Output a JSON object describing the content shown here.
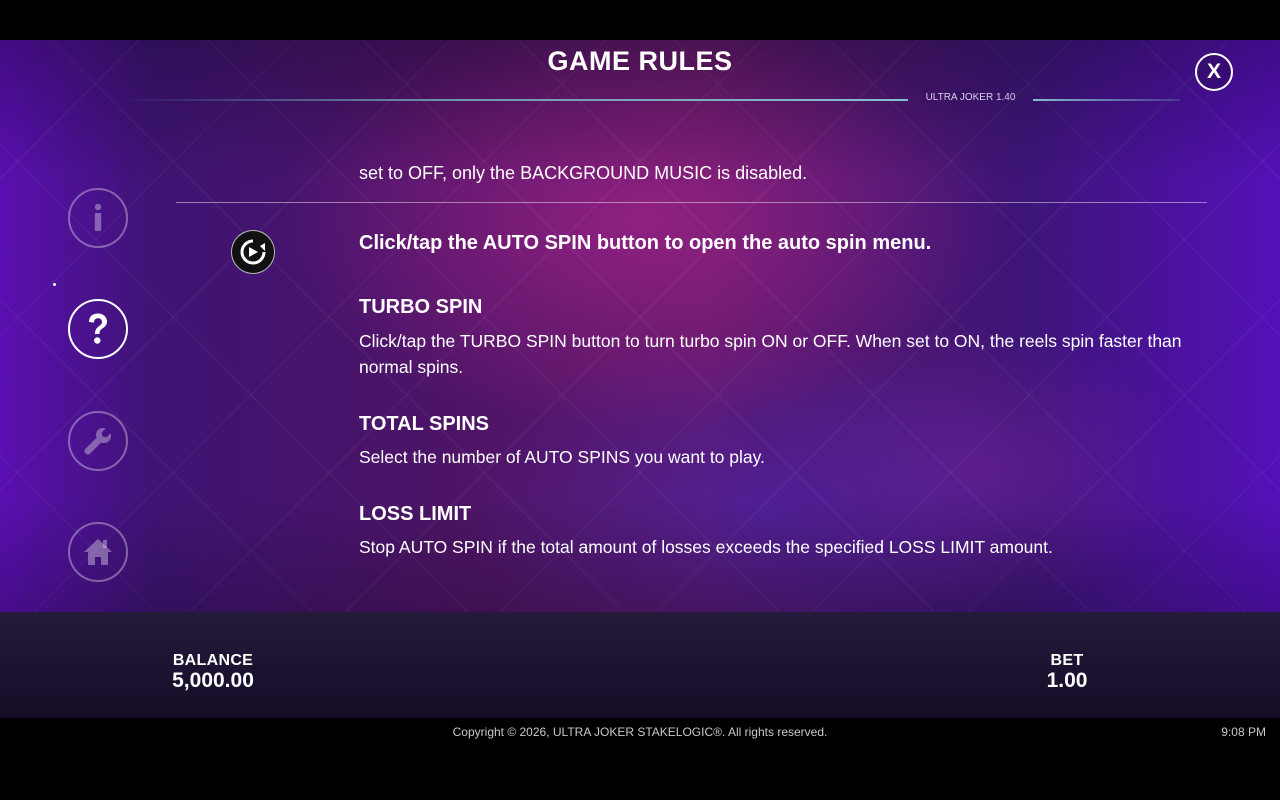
{
  "header": {
    "title": "GAME RULES",
    "version": "ULTRA JOKER 1.40",
    "close_label": "X"
  },
  "side_menu": {
    "items": [
      {
        "name": "info",
        "icon": "info-icon",
        "active": false
      },
      {
        "name": "help",
        "icon": "question-icon",
        "active": true
      },
      {
        "name": "settings",
        "icon": "wrench-icon",
        "active": false
      },
      {
        "name": "home",
        "icon": "home-icon",
        "active": false
      }
    ]
  },
  "rules": {
    "prev_text": "set to OFF, only the BACKGROUND MUSIC is disabled.",
    "autospin": {
      "icon": "autospin-icon",
      "text": "Click/tap the AUTO SPIN button to open the auto spin menu."
    },
    "sections": [
      {
        "title": "TURBO SPIN",
        "body": "Click/tap the TURBO SPIN button to turn turbo spin ON or OFF. When set to ON, the reels spin faster than normal spins."
      },
      {
        "title": "TOTAL SPINS",
        "body": "Select the number of AUTO SPINS you want to play."
      },
      {
        "title": "LOSS LIMIT",
        "body": "Stop AUTO SPIN if the total amount of losses exceeds the specified LOSS LIMIT amount."
      }
    ]
  },
  "status": {
    "balance_label": "BALANCE",
    "balance_value": "5,000.00",
    "bet_label": "BET",
    "bet_value": "1.00"
  },
  "footer": {
    "copyright": "Copyright © 2026, ULTRA JOKER STAKELOGIC®. All rights reserved.",
    "time": "9:08 PM"
  },
  "colors": {
    "accent_line": "#8cd2dc",
    "bottom_bar": "#1b1230"
  }
}
